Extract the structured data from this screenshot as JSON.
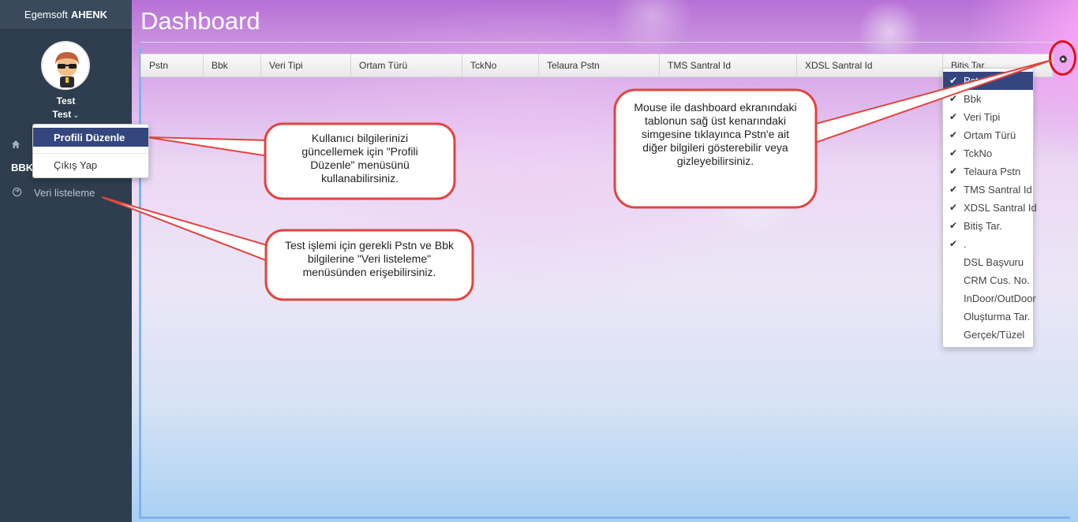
{
  "sidebar": {
    "brand_prefix": "Egemsoft",
    "brand_name": "AHENK",
    "user_name": "Test",
    "user_menu_label": "Test",
    "section_label": "BBK",
    "nav_item_label": "Veri listeleme"
  },
  "user_dropdown": {
    "items": [
      "Profili Düzenle",
      "Çıkış Yap"
    ]
  },
  "main": {
    "title": "Dashboard",
    "columns": [
      "Pstn",
      "Bbk",
      "Veri Tipi",
      "Ortam Türü",
      "TckNo",
      "Telaura Pstn",
      "TMS Santral Id",
      "XDSL Santral Id",
      "Bitiş Tar."
    ]
  },
  "column_menu": {
    "options": [
      {
        "label": "Pstn",
        "checked": true
      },
      {
        "label": "Bbk",
        "checked": true
      },
      {
        "label": "Veri Tipi",
        "checked": true
      },
      {
        "label": "Ortam Türü",
        "checked": true
      },
      {
        "label": "TckNo",
        "checked": true
      },
      {
        "label": "Telaura Pstn",
        "checked": true
      },
      {
        "label": "TMS Santral Id",
        "checked": true
      },
      {
        "label": "XDSL Santral Id",
        "checked": true
      },
      {
        "label": "Bitiş Tar.",
        "checked": true
      },
      {
        "label": ".",
        "checked": true
      },
      {
        "label": "DSL Başvuru",
        "checked": false
      },
      {
        "label": "CRM Cus. No.",
        "checked": false
      },
      {
        "label": "InDoor/OutDoor",
        "checked": false
      },
      {
        "label": "Oluşturma Tar.",
        "checked": false
      },
      {
        "label": "Gerçek/Tüzel",
        "checked": false
      }
    ]
  },
  "callouts": {
    "profile": "Kullanıcı bilgilerinizi güncellemek için \"Profili Düzenle\" menüsünü kullanabilirsiniz.",
    "list": "Test işlemi için gerekli Pstn ve Bbk  bilgilerine \"Veri listeleme\" menüsünden erişebilirsiniz.",
    "columns": "Mouse ile dashboard ekranındaki tablonun sağ üst kenarındaki simgesine tıklayınca Pstn'e ait diğer bilgileri gösterebilir veya gizleyebilirsiniz."
  },
  "colors": {
    "sidebar_bg": "#2f3e4e",
    "menu_active": "#34467d",
    "callout_border": "#e0453f",
    "highlight_circle": "#e0101a"
  }
}
